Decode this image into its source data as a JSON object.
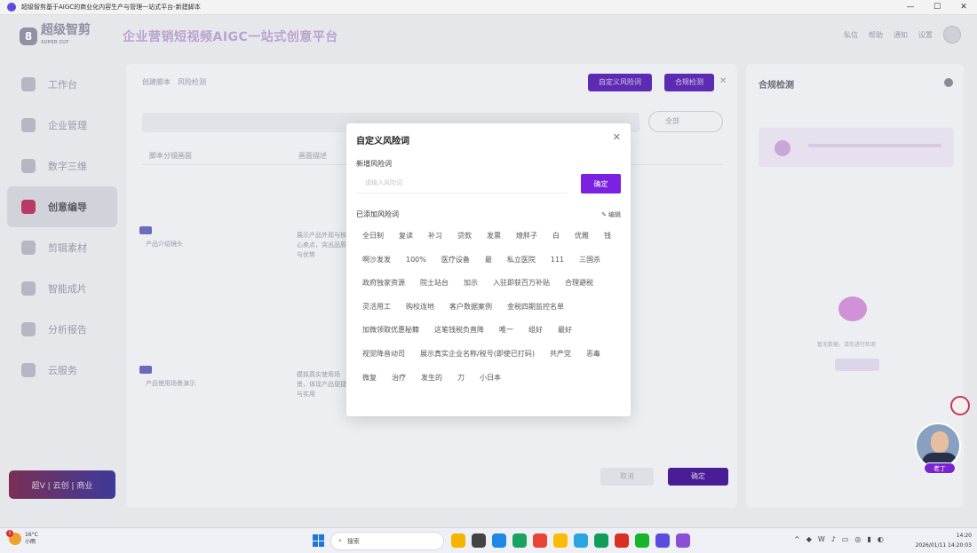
{
  "window": {
    "title": "超级智剪基于AIGC的商业化内容生产与管理一站式平台-新建脚本",
    "controls": [
      "—",
      "☐",
      "✕"
    ]
  },
  "app": {
    "logo": {
      "name": "超级智剪",
      "sub": "SUPER CUT"
    },
    "slogan": "企业营销短视频AIGC一站式创意平台",
    "header_icons": [
      "私信",
      "帮助",
      "通知",
      "设置"
    ],
    "sidebar": [
      {
        "label": "工作台",
        "active": false
      },
      {
        "label": "企业管理",
        "active": false
      },
      {
        "label": "数字三维",
        "active": false
      },
      {
        "label": "创意编导",
        "active": true
      },
      {
        "label": "剪辑素材",
        "active": false
      },
      {
        "label": "智能成片",
        "active": false
      },
      {
        "label": "分析报告",
        "active": false
      },
      {
        "label": "云服务",
        "active": false
      }
    ],
    "promo": "超V | 云创 | 商业",
    "main": {
      "breadcrumb": [
        "创建脚本",
        "风险检测"
      ],
      "custom_risk_button": "自定义风险词",
      "detect_button": "合规检测",
      "select_label": "全部",
      "col_headers": [
        "脚本分镜画面",
        "画面描述"
      ],
      "row1_tag": "01",
      "row1_title": "产品介绍镜头",
      "row1_desc": "展示产品外观与核心卖点，突出品质与优势",
      "row2_tag": "02",
      "row2_title": "产品使用场景演示",
      "row2_desc": "模拟真实使用场景，体现产品便捷与实用",
      "cancel": "取消",
      "confirm": "确定"
    },
    "right": {
      "title": "合规检测",
      "empty_text": "暂无数据，请先进行检测",
      "empty_button": "开始检测"
    },
    "assistant_label": "老丁"
  },
  "modal": {
    "title": "自定义风险词",
    "close": "✕",
    "add_label": "新增风险词",
    "input_placeholder": "请输入风险词",
    "confirm": "确定",
    "added_label": "已添加风险词",
    "edit_label": "编辑",
    "tags": [
      "全日制",
      "复读",
      "补习",
      "贷款",
      "发票",
      "燎胖子",
      "白",
      "优雅",
      "钱",
      "啊沙发发",
      "100%",
      "医疗设备",
      "最",
      "私立医院",
      "111",
      "三国杀",
      "政府独家资源",
      "院士站台",
      "加示",
      "入驻即获百万补贴",
      "合理避税",
      "灵活用工",
      "购校连地",
      "客户数据案例",
      "金税四期监控名单",
      "加微领取优惠秘籍",
      "这笔钱税负直降",
      "唯一",
      "组好",
      "最好",
      "视觉降音动司",
      "展示真实企业名称/税号(即使已打码)",
      "共产党",
      "恶毒",
      "微复",
      "治疗",
      "发生的",
      "刀",
      "小日本"
    ]
  },
  "taskbar": {
    "weather_temp": "16°C",
    "weather_desc": "小雨",
    "search": "搜索",
    "app_colors": [
      "#f4b400",
      "#444444",
      "#1e88e5",
      "#1aa260",
      "#ea4335",
      "#fbbc05",
      "#2aa5e0",
      "#0f9d58",
      "#d93025",
      "#17b52b",
      "#5b4cdb",
      "#8a4fd6"
    ],
    "time": "14:20",
    "date": "2026/01/11 14:20:03"
  }
}
